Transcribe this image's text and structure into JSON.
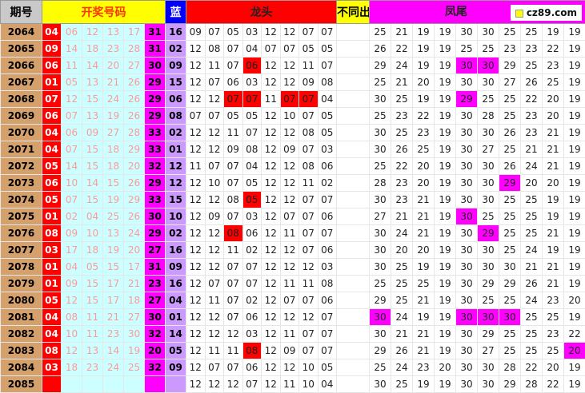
{
  "header": {
    "period": "期号",
    "draw": "开奖号码",
    "blue": "蓝",
    "dragon": "龙头",
    "nodiff": "不同出",
    "phoenix": "凤尾",
    "site": "cz89.com"
  },
  "colors": {
    "red": "#ff0000",
    "magenta": "#ff00ff",
    "cyan": "#ccffff",
    "lavender": "#cc99ff",
    "period": "#d4a06c",
    "yellow": "#ffff00",
    "blue": "#0000ff"
  },
  "rows": [
    {
      "period": "2064",
      "reds": [
        "04",
        "06",
        "12",
        "13",
        "17"
      ],
      "mag": "31",
      "blue": "16",
      "dragon": [
        "09",
        "07",
        "05",
        "03",
        "12",
        "12",
        "07",
        "07"
      ],
      "dh": [],
      "phoenix": [
        "25",
        "21",
        "19",
        "19",
        "30",
        "30",
        "25",
        "25",
        "19",
        "19"
      ],
      "ph": []
    },
    {
      "period": "2065",
      "reds": [
        "09",
        "14",
        "18",
        "23",
        "28"
      ],
      "mag": "31",
      "blue": "02",
      "dragon": [
        "12",
        "08",
        "07",
        "04",
        "07",
        "07",
        "05",
        "05"
      ],
      "dh": [],
      "phoenix": [
        "26",
        "22",
        "19",
        "19",
        "25",
        "25",
        "23",
        "23",
        "22",
        "19"
      ],
      "ph": []
    },
    {
      "period": "2066",
      "reds": [
        "06",
        "11",
        "14",
        "20",
        "27"
      ],
      "mag": "30",
      "blue": "09",
      "dragon": [
        "12",
        "11",
        "07",
        "06",
        "12",
        "12",
        "11",
        "07"
      ],
      "dh": [
        3
      ],
      "phoenix": [
        "29",
        "24",
        "19",
        "19",
        "30",
        "30",
        "29",
        "25",
        "23",
        "19"
      ],
      "ph": [
        4,
        5
      ]
    },
    {
      "period": "2067",
      "reds": [
        "01",
        "05",
        "13",
        "21",
        "26"
      ],
      "mag": "29",
      "blue": "15",
      "dragon": [
        "12",
        "07",
        "06",
        "03",
        "12",
        "12",
        "09",
        "08"
      ],
      "dh": [],
      "phoenix": [
        "25",
        "21",
        "20",
        "19",
        "30",
        "30",
        "27",
        "26",
        "25",
        "19"
      ],
      "ph": []
    },
    {
      "period": "2068",
      "reds": [
        "07",
        "12",
        "15",
        "24",
        "26"
      ],
      "mag": "29",
      "blue": "06",
      "dragon": [
        "12",
        "12",
        "07",
        "07",
        "11",
        "07",
        "07",
        "04"
      ],
      "dh": [
        2,
        3,
        5,
        6
      ],
      "phoenix": [
        "30",
        "25",
        "19",
        "19",
        "29",
        "25",
        "25",
        "22",
        "20",
        "19"
      ],
      "ph": [
        4
      ]
    },
    {
      "period": "2069",
      "reds": [
        "06",
        "07",
        "13",
        "19",
        "26"
      ],
      "mag": "29",
      "blue": "08",
      "dragon": [
        "07",
        "07",
        "05",
        "05",
        "12",
        "10",
        "07",
        "05"
      ],
      "dh": [],
      "phoenix": [
        "25",
        "23",
        "22",
        "19",
        "30",
        "28",
        "25",
        "23",
        "20",
        "19"
      ],
      "ph": []
    },
    {
      "period": "2070",
      "reds": [
        "04",
        "06",
        "09",
        "27",
        "28"
      ],
      "mag": "33",
      "blue": "02",
      "dragon": [
        "12",
        "12",
        "11",
        "07",
        "12",
        "12",
        "08",
        "05"
      ],
      "dh": [],
      "phoenix": [
        "30",
        "25",
        "23",
        "19",
        "30",
        "30",
        "26",
        "23",
        "21",
        "19"
      ],
      "ph": []
    },
    {
      "period": "2071",
      "reds": [
        "04",
        "07",
        "15",
        "18",
        "29"
      ],
      "mag": "33",
      "blue": "01",
      "dragon": [
        "12",
        "12",
        "09",
        "08",
        "12",
        "09",
        "07",
        "03"
      ],
      "dh": [],
      "phoenix": [
        "30",
        "26",
        "25",
        "19",
        "30",
        "27",
        "25",
        "21",
        "21",
        "19"
      ],
      "ph": []
    },
    {
      "period": "2072",
      "reds": [
        "05",
        "14",
        "15",
        "18",
        "20"
      ],
      "mag": "32",
      "blue": "12",
      "dragon": [
        "11",
        "07",
        "07",
        "04",
        "12",
        "12",
        "08",
        "06"
      ],
      "dh": [],
      "phoenix": [
        "25",
        "22",
        "20",
        "19",
        "30",
        "30",
        "26",
        "24",
        "21",
        "19"
      ],
      "ph": []
    },
    {
      "period": "2073",
      "reds": [
        "06",
        "10",
        "14",
        "15",
        "26"
      ],
      "mag": "29",
      "blue": "12",
      "dragon": [
        "12",
        "10",
        "07",
        "05",
        "12",
        "12",
        "11",
        "02"
      ],
      "dh": [],
      "phoenix": [
        "28",
        "23",
        "20",
        "19",
        "30",
        "30",
        "29",
        "20",
        "20",
        "19"
      ],
      "ph": [
        6
      ]
    },
    {
      "period": "2074",
      "reds": [
        "05",
        "07",
        "15",
        "19",
        "29"
      ],
      "mag": "33",
      "blue": "15",
      "dragon": [
        "12",
        "12",
        "08",
        "05",
        "12",
        "12",
        "07",
        "07"
      ],
      "dh": [
        3
      ],
      "phoenix": [
        "30",
        "23",
        "21",
        "19",
        "30",
        "30",
        "25",
        "25",
        "19",
        "19"
      ],
      "ph": []
    },
    {
      "period": "2075",
      "reds": [
        "01",
        "02",
        "04",
        "25",
        "26"
      ],
      "mag": "30",
      "blue": "10",
      "dragon": [
        "12",
        "09",
        "07",
        "03",
        "12",
        "07",
        "07",
        "06"
      ],
      "dh": [],
      "phoenix": [
        "27",
        "21",
        "21",
        "19",
        "30",
        "25",
        "25",
        "25",
        "19",
        "19"
      ],
      "ph": [
        4
      ]
    },
    {
      "period": "2076",
      "reds": [
        "08",
        "09",
        "10",
        "13",
        "24"
      ],
      "mag": "29",
      "blue": "02",
      "dragon": [
        "12",
        "12",
        "08",
        "06",
        "12",
        "11",
        "07",
        "07"
      ],
      "dh": [
        2
      ],
      "phoenix": [
        "30",
        "24",
        "21",
        "19",
        "30",
        "29",
        "25",
        "25",
        "21",
        "19"
      ],
      "ph": [
        5
      ]
    },
    {
      "period": "2077",
      "reds": [
        "03",
        "17",
        "18",
        "19",
        "20"
      ],
      "mag": "27",
      "blue": "16",
      "dragon": [
        "12",
        "12",
        "11",
        "02",
        "12",
        "12",
        "07",
        "06"
      ],
      "dh": [],
      "phoenix": [
        "30",
        "20",
        "20",
        "19",
        "30",
        "30",
        "25",
        "24",
        "19",
        "19"
      ],
      "ph": []
    },
    {
      "period": "2078",
      "reds": [
        "01",
        "04",
        "05",
        "15",
        "17"
      ],
      "mag": "31",
      "blue": "09",
      "dragon": [
        "12",
        "12",
        "07",
        "07",
        "12",
        "12",
        "12",
        "03"
      ],
      "dh": [],
      "phoenix": [
        "30",
        "25",
        "19",
        "19",
        "30",
        "30",
        "30",
        "21",
        "21",
        "19"
      ],
      "ph": []
    },
    {
      "period": "2079",
      "reds": [
        "01",
        "09",
        "15",
        "17",
        "21"
      ],
      "mag": "23",
      "blue": "16",
      "dragon": [
        "12",
        "07",
        "07",
        "07",
        "12",
        "11",
        "11",
        "08"
      ],
      "dh": [],
      "phoenix": [
        "25",
        "25",
        "25",
        "19",
        "30",
        "29",
        "29",
        "26",
        "21",
        "19"
      ],
      "ph": []
    },
    {
      "period": "2080",
      "reds": [
        "05",
        "12",
        "15",
        "17",
        "18"
      ],
      "mag": "27",
      "blue": "04",
      "dragon": [
        "12",
        "11",
        "07",
        "02",
        "12",
        "07",
        "07",
        "06"
      ],
      "dh": [],
      "phoenix": [
        "29",
        "25",
        "21",
        "19",
        "30",
        "25",
        "25",
        "24",
        "23",
        "20"
      ],
      "ph": []
    },
    {
      "period": "2081",
      "reds": [
        "04",
        "08",
        "11",
        "21",
        "27"
      ],
      "mag": "30",
      "blue": "01",
      "dragon": [
        "12",
        "12",
        "07",
        "06",
        "12",
        "12",
        "12",
        "07"
      ],
      "dh": [],
      "phoenix": [
        "30",
        "24",
        "19",
        "19",
        "30",
        "30",
        "30",
        "25",
        "25",
        "19"
      ],
      "ph": [
        0,
        4,
        5,
        6
      ]
    },
    {
      "period": "2082",
      "reds": [
        "04",
        "10",
        "11",
        "23",
        "30"
      ],
      "mag": "32",
      "blue": "14",
      "dragon": [
        "12",
        "12",
        "12",
        "03",
        "12",
        "11",
        "07",
        "07"
      ],
      "dh": [],
      "phoenix": [
        "30",
        "21",
        "21",
        "19",
        "30",
        "29",
        "25",
        "25",
        "23",
        "22"
      ],
      "ph": []
    },
    {
      "period": "2083",
      "reds": [
        "08",
        "12",
        "13",
        "14",
        "19"
      ],
      "mag": "20",
      "blue": "05",
      "dragon": [
        "12",
        "11",
        "11",
        "08",
        "12",
        "09",
        "07",
        "07"
      ],
      "dh": [
        3
      ],
      "phoenix": [
        "29",
        "26",
        "21",
        "19",
        "30",
        "27",
        "25",
        "25",
        "25",
        "20"
      ],
      "ph": [
        9
      ]
    },
    {
      "period": "2084",
      "reds": [
        "03",
        "18",
        "23",
        "24",
        "25"
      ],
      "mag": "32",
      "blue": "09",
      "dragon": [
        "12",
        "07",
        "07",
        "06",
        "12",
        "12",
        "10",
        "05"
      ],
      "dh": [],
      "phoenix": [
        "25",
        "24",
        "23",
        "20",
        "30",
        "30",
        "28",
        "22",
        "20",
        "19"
      ],
      "ph": []
    },
    {
      "period": "2085",
      "reds": [
        "",
        "",
        "",
        "",
        ""
      ],
      "mag": "",
      "blue": "",
      "dragon": [
        "12",
        "12",
        "12",
        "07",
        "12",
        "11",
        "10",
        "04"
      ],
      "dh": [],
      "phoenix": [
        "30",
        "25",
        "19",
        "19",
        "30",
        "30",
        "29",
        "28",
        "22",
        "19"
      ],
      "ph": []
    }
  ]
}
